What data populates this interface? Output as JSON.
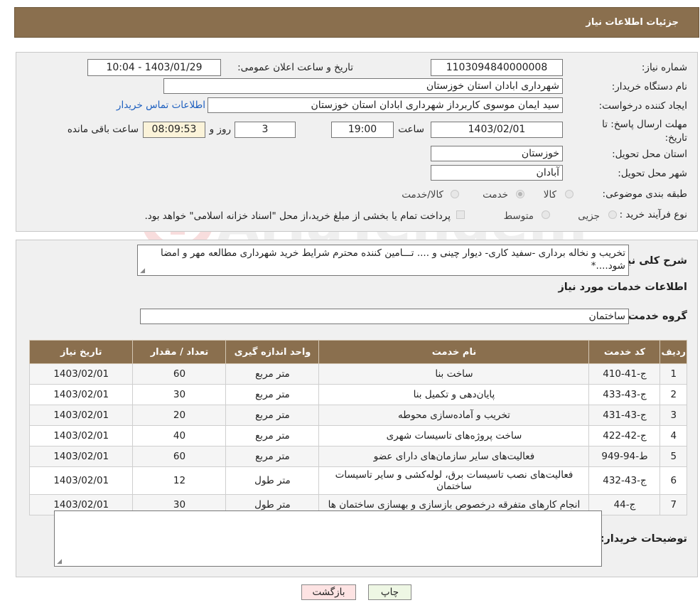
{
  "header": {
    "title": "جزئیات اطلاعات نیاز"
  },
  "form": {
    "need_number_label": "شماره نیاز:",
    "need_number": "1103094840000008",
    "announce_label": "تاریخ و ساعت اعلان عمومی:",
    "announce_value": "1403/01/29 - 10:04",
    "buyer_org_label": "نام دستگاه خریدار:",
    "buyer_org": "شهرداری ابادان استان خوزستان",
    "requester_label": "ایجاد کننده درخواست:",
    "requester": "سید ایمان موسوی کاربرداز شهرداری ابادان استان خوزستان",
    "contact_link": "اطلاعات تماس خریدار",
    "deadline_label": "مهلت ارسال پاسخ: تا تاریخ:",
    "deadline_date": "1403/02/01",
    "time_label": "ساعت",
    "deadline_time": "19:00",
    "days": "3",
    "days_label": "روز و",
    "remaining": "08:09:53",
    "remaining_label": "ساعت باقی مانده",
    "province_label": "استان محل تحویل:",
    "province": "خوزستان",
    "city_label": "شهر محل تحویل:",
    "city": "آبادان",
    "category_label": "طبقه بندی موضوعی:",
    "category_options": [
      "کالا",
      "خدمت",
      "کالا/خدمت"
    ],
    "category_selected": "خدمت",
    "process_label": "نوع فرآیند خرید :",
    "process_options": [
      "جزیی",
      "متوسط"
    ],
    "process_note": "پرداخت تمام یا بخشی از مبلغ خرید،از محل \"اسناد خزانه اسلامی\" خواهد بود."
  },
  "description": {
    "label": "شرح کلی نیاز:",
    "text": "تخریب و نخاله برداری -سفید کاری- دیوار چینی و .... تـــامین کننده محترم شرایط خرید شهرداری مطالعه مهر و امضا شود....*"
  },
  "services": {
    "section_title": "اطلاعات خدمات مورد نیاز",
    "group_label": "گروه خدمت:",
    "group_value": "ساختمان",
    "columns": [
      "ردیف",
      "کد خدمت",
      "نام خدمت",
      "واحد اندازه گیری",
      "تعداد / مقدار",
      "تاریخ نیاز"
    ],
    "rows": [
      [
        "1",
        "ج-41-410",
        "ساخت بنا",
        "متر مربع",
        "60",
        "1403/02/01"
      ],
      [
        "2",
        "ج-43-433",
        "پایان‌دهی و تکمیل بنا",
        "متر مربع",
        "30",
        "1403/02/01"
      ],
      [
        "3",
        "ج-43-431",
        "تخریب و آماده‌سازی محوطه",
        "متر مربع",
        "20",
        "1403/02/01"
      ],
      [
        "4",
        "ج-42-422",
        "ساخت پروژه‌های تاسیسات شهری",
        "متر مربع",
        "40",
        "1403/02/01"
      ],
      [
        "5",
        "ط-94-949",
        "فعالیت‌های سایر سازمان‌های دارای عضو",
        "متر مربع",
        "60",
        "1403/02/01"
      ],
      [
        "6",
        "ج-43-432",
        "فعالیت‌های نصب تاسیسات برق، لوله‌کشی و سایر تاسیسات ساختمان",
        "متر طول",
        "12",
        "1403/02/01"
      ],
      [
        "7",
        "ج-44",
        "انجام کارهای متفرقه درخصوص بازسازی و بهسازی ساختمان ها",
        "متر طول",
        "30",
        "1403/02/01"
      ]
    ]
  },
  "buyer_notes": {
    "label": "توضیحات خریدار:",
    "text": ""
  },
  "buttons": {
    "print": "چاپ",
    "back": "بازگشت"
  },
  "watermark": "AriaTender.neT"
}
